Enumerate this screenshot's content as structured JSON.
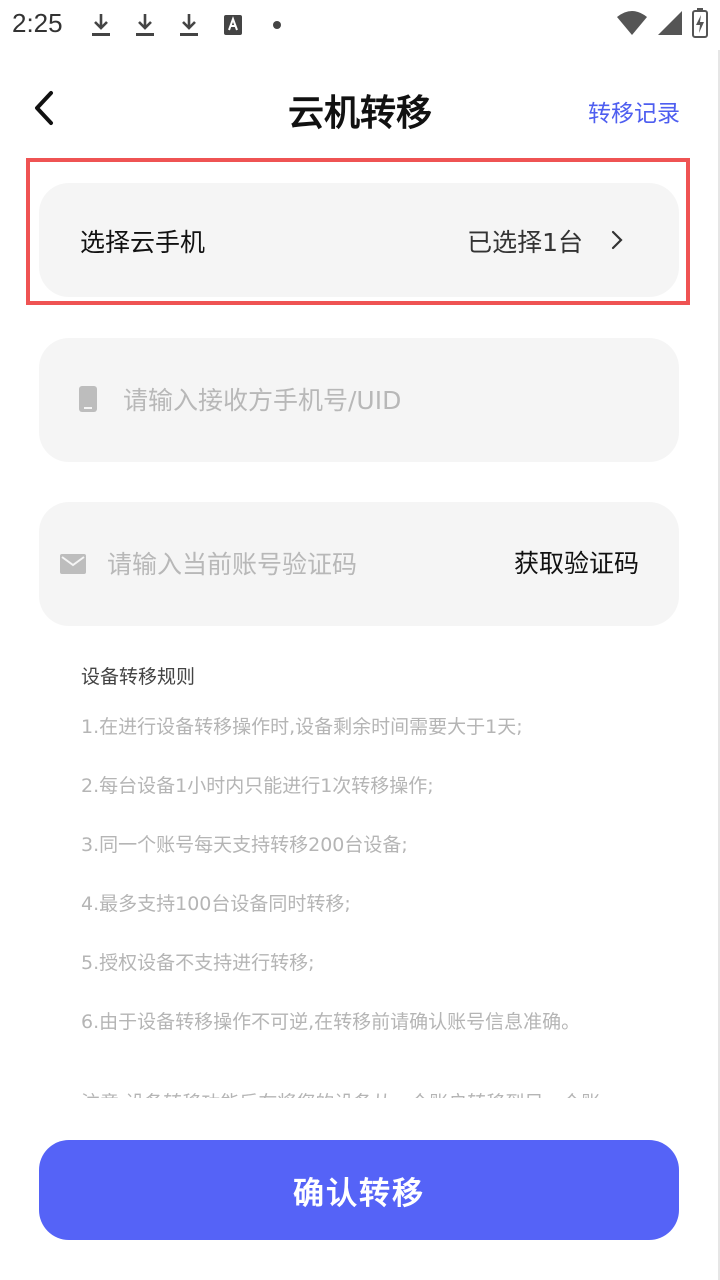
{
  "status_bar": {
    "time": "2:25",
    "left_icons": [
      "download-icon",
      "download-icon",
      "download-icon",
      "a-badge-icon",
      "dot-icon"
    ],
    "right_icons": [
      "wifi-icon",
      "signal-icon",
      "battery-charging-icon"
    ]
  },
  "header": {
    "title": "云机转移",
    "right_link": "转移记录",
    "back_icon": "chevron-left-icon"
  },
  "select_card": {
    "label": "选择云手机",
    "value": "已选择1台"
  },
  "phone_field": {
    "placeholder": "请输入接收方手机号/UID",
    "value": ""
  },
  "code_field": {
    "placeholder": "请输入当前账号验证码",
    "value": "",
    "button_label": "获取验证码"
  },
  "rules": {
    "title": "设备转移规则",
    "items": [
      "1.在进行设备转移操作时,设备剩余时间需要大于1天;",
      "2.每台设备1小时内只能进行1次转移操作;",
      "3.同一个账号每天支持转移200台设备;",
      "4.最多支持100台设备同时转移;",
      "5.授权设备不支持进行转移;",
      "6.由于设备转移操作不可逆,在转移前请确认账号信息准确。"
    ],
    "note": "注意:设备转移功能后在将您的设备从一个账户转移到另一个账"
  },
  "confirm_button": {
    "label": "确认转移"
  },
  "colors": {
    "accent": "#5563f7",
    "link": "#4e5ef0",
    "highlight": "#ef5353",
    "card_bg": "#f5f5f5"
  }
}
